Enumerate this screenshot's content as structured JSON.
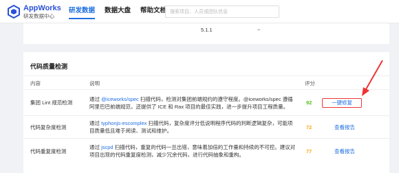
{
  "header": {
    "app_name": "AppWorks",
    "app_sub": "研发数据中心",
    "nav": [
      "研发数据",
      "数据大盘",
      "帮助文档"
    ],
    "search_placeholder": "搜索项目、人员或团队信息"
  },
  "version_row": {
    "version": "5.1.1",
    "extra": "~"
  },
  "quality": {
    "title": "代码质量检测",
    "columns": [
      "内容",
      "说明",
      "评分"
    ],
    "rows": [
      {
        "name": "集团 Lint 规范检测",
        "desc_pre": "通过 ",
        "desc_link": "@iceworks/spec",
        "desc_post": " 扫描代码，检测对集团前端规约的遵守程度。@iceworks/spec 遵循阿里巴巴前端规范，还提供了 ICE 和 Rax 项目的最佳实践，进一步提升项目工程质量。",
        "score": "92",
        "score_color": "#52c41a",
        "action": "一键修复"
      },
      {
        "name": "代码复杂度检测",
        "desc_pre": "通过 ",
        "desc_link": "typhonjs-escomplex",
        "desc_post": " 扫描代码，复杂度评分低说明程序代码的判断逻辑复杂，可能项目质量低且难于阅读、测试和维护。",
        "score": "72",
        "score_color": "#faad14",
        "action": "查看报告"
      },
      {
        "name": "代码重复度检测",
        "desc_pre": "通过 ",
        "desc_link": "jscpd",
        "desc_post": " 扫描代码，重复的代码一旦出错，意味着加倍的工作量和持续的不可控。建议对项目出现的代码重复度检测，减少冗余代码，进行代码抽象和重构。",
        "score": "77",
        "score_color": "#faad14",
        "action": "查看报告"
      }
    ]
  },
  "colors": {
    "accent": "#1f6fe0",
    "highlight": "#e33333"
  }
}
